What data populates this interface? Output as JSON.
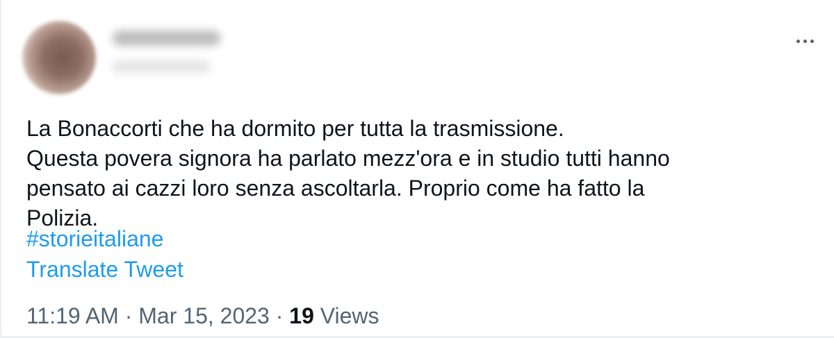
{
  "tweet": {
    "text_lines": [
      "La Bonaccorti che ha dormito per tutta la trasmissione.",
      "Questa povera signora ha parlato mezz'ora e in studio tutti hanno",
      "pensato ai cazzi loro senza ascoltarla. Proprio come ha fatto la",
      "Polizia."
    ],
    "hashtag": "#storieitaliane",
    "translate_label": "Translate Tweet",
    "time": "11:19 AM",
    "separator": "·",
    "date": "Mar 15, 2023",
    "views_count": "19",
    "views_label": "Views"
  },
  "header": {
    "more_icon": "more-horizontal-icon"
  },
  "colors": {
    "text": "#0f1419",
    "secondary": "#536471",
    "link": "#1d9bf0"
  }
}
